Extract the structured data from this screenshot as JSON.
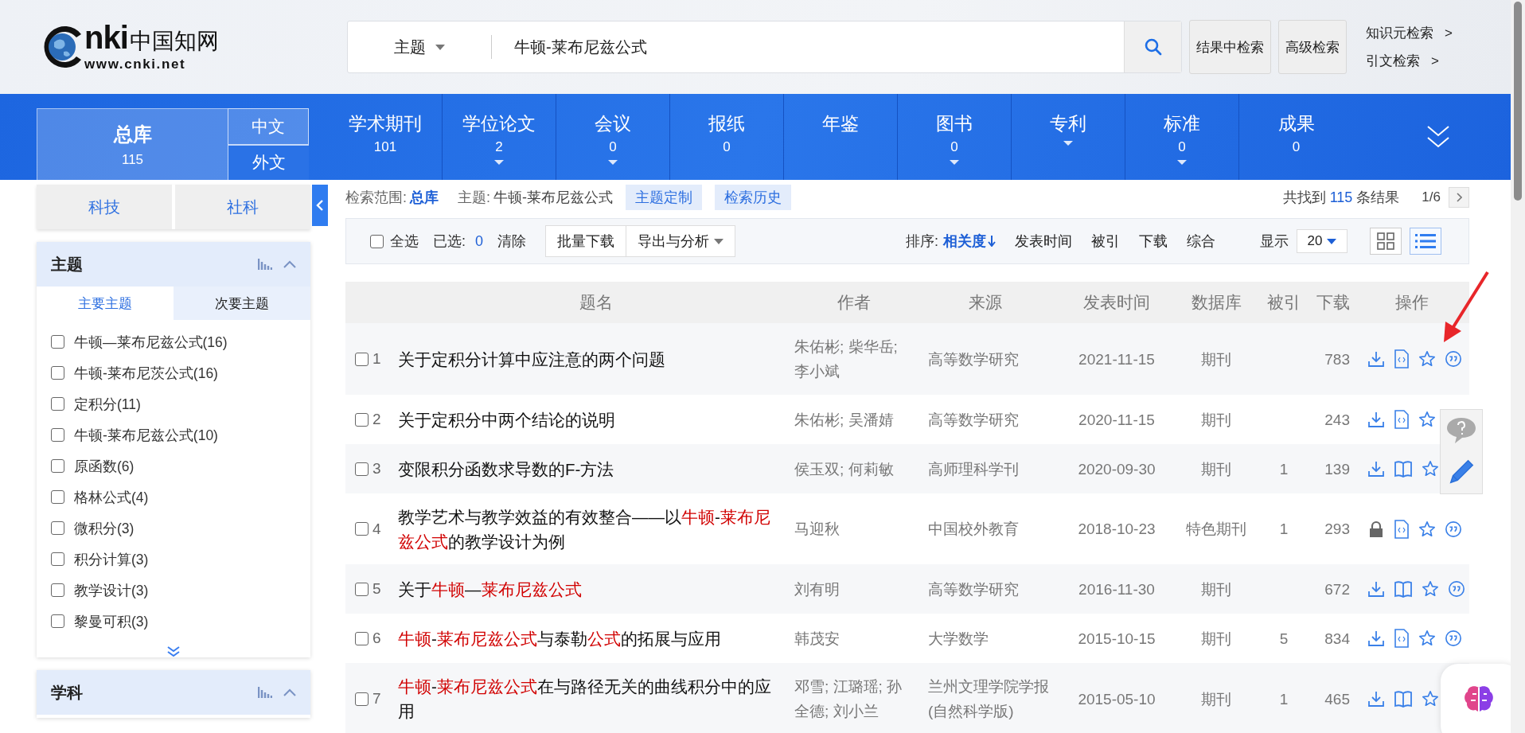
{
  "logo": {
    "mark": "nki",
    "name": "中国知网",
    "url": "www.cnki.net"
  },
  "search": {
    "field": "主题",
    "query": "牛顿-莱布尼兹公式"
  },
  "header_buttons": [
    "结果中检索",
    "高级检索"
  ],
  "header_links": [
    {
      "label": "知识元检索",
      "arrow": ">"
    },
    {
      "label": "引文检索",
      "arrow": ">"
    }
  ],
  "database_tabs": {
    "all": {
      "label": "总库",
      "count": "115"
    },
    "languages": [
      {
        "label": "中文",
        "selected": true
      },
      {
        "label": "外文",
        "selected": false
      }
    ]
  },
  "categories": [
    {
      "label": "学术期刊",
      "count": "101",
      "has_menu": false
    },
    {
      "label": "学位论文",
      "count": "2",
      "has_menu": true
    },
    {
      "label": "会议",
      "count": "0",
      "has_menu": true
    },
    {
      "label": "报纸",
      "count": "0",
      "has_menu": false
    },
    {
      "label": "年鉴",
      "has_menu": false
    },
    {
      "label": "图书",
      "count": "0",
      "has_menu": true
    },
    {
      "label": "专利",
      "has_menu": true
    },
    {
      "label": "标准",
      "count": "0",
      "has_menu": true
    },
    {
      "label": "成果",
      "count": "0",
      "has_menu": false
    }
  ],
  "sidebar": {
    "field_tabs": [
      "科技",
      "社科"
    ],
    "facets": [
      {
        "title": "主题",
        "subtabs": [
          {
            "label": "主要主题",
            "selected": true
          },
          {
            "label": "次要主题",
            "selected": false
          }
        ],
        "items": [
          {
            "label": "牛顿—莱布尼兹公式(16)",
            "checked": false
          },
          {
            "label": "牛顿-莱布尼茨公式(16)",
            "checked": false
          },
          {
            "label": "定积分(11)",
            "checked": false
          },
          {
            "label": "牛顿-莱布尼兹公式(10)",
            "checked": false
          },
          {
            "label": "原函数(6)",
            "checked": false
          },
          {
            "label": "格林公式(4)",
            "checked": false
          },
          {
            "label": "微积分(3)",
            "checked": false
          },
          {
            "label": "积分计算(3)",
            "checked": false
          },
          {
            "label": "教学设计(3)",
            "checked": false
          },
          {
            "label": "黎曼可积(3)",
            "checked": false
          }
        ]
      },
      {
        "title": "学科"
      }
    ]
  },
  "breadcrumb": {
    "scope_label": "检索范围:",
    "scope": "总库",
    "query_label": "主题:",
    "query": "牛顿-莱布尼兹公式",
    "actions": [
      "主题定制",
      "检索历史"
    ]
  },
  "result_summary": {
    "prefix": "共找到",
    "count": "115",
    "suffix": "条结果",
    "page": "1/6"
  },
  "toolbar": {
    "select_all": {
      "label": "全选",
      "checked": false
    },
    "selected_label": "已选:",
    "selected_count": "0",
    "clear": "清除",
    "buttons": [
      {
        "label": "批量下载",
        "has_menu": false
      },
      {
        "label": "导出与分析",
        "has_menu": true
      }
    ],
    "sort_label": "排序:",
    "sort_options": [
      {
        "label": "相关度",
        "selected": true
      },
      {
        "label": "发表时间",
        "selected": false
      },
      {
        "label": "被引",
        "selected": false
      },
      {
        "label": "下载",
        "selected": false
      },
      {
        "label": "综合",
        "selected": false
      }
    ],
    "page_size_label": "显示",
    "page_size": "20",
    "views": [
      {
        "kind": "grid",
        "selected": false
      },
      {
        "kind": "list",
        "selected": true
      }
    ]
  },
  "table": {
    "columns": [
      "题名",
      "作者",
      "来源",
      "发表时间",
      "数据库",
      "被引",
      "下载",
      "操作"
    ],
    "rows": [
      {
        "number": "1",
        "checked": false,
        "title": [
          {
            "text": "关于定积分计算中应注意的两个问题",
            "highlight": false
          }
        ],
        "authors": "朱佑彬; 柴华岳; 李小斌",
        "source": "高等数学研究",
        "date": "2021-11-15",
        "database": "期刊",
        "downloads": "783",
        "actions": [
          {
            "kind": "download"
          },
          {
            "kind": "html"
          },
          {
            "kind": "favorite"
          },
          {
            "kind": "cite"
          }
        ]
      },
      {
        "number": "2",
        "checked": false,
        "title": [
          {
            "text": "关于定积分中两个结论的说明",
            "highlight": false
          }
        ],
        "authors": "朱佑彬; 吴潘婧",
        "source": "高等数学研究",
        "date": "2020-11-15",
        "database": "期刊",
        "downloads": "243",
        "actions": [
          {
            "kind": "download"
          },
          {
            "kind": "html"
          },
          {
            "kind": "favorite"
          }
        ]
      },
      {
        "number": "3",
        "checked": false,
        "title": [
          {
            "text": "变限积分函数求导数的F-方法",
            "highlight": false
          }
        ],
        "authors": "侯玉双; 何莉敏",
        "source": "高师理科学刊",
        "date": "2020-09-30",
        "database": "期刊",
        "cited": "1",
        "downloads": "139",
        "actions": [
          {
            "kind": "download"
          },
          {
            "kind": "read"
          },
          {
            "kind": "favorite"
          }
        ]
      },
      {
        "number": "4",
        "checked": false,
        "title": [
          {
            "text": "教学艺术与教学效益的有效整合——以",
            "highlight": false
          },
          {
            "text": "牛顿",
            "highlight": true
          },
          {
            "text": "-",
            "highlight": false
          },
          {
            "text": "莱布尼兹公式",
            "highlight": true
          },
          {
            "text": "的教学设计为例",
            "highlight": false
          }
        ],
        "authors": "马迎秋",
        "source": "中国校外教育",
        "date": "2018-10-23",
        "database": "特色期刊",
        "cited": "1",
        "downloads": "293",
        "actions": [
          {
            "kind": "locked"
          },
          {
            "kind": "html"
          },
          {
            "kind": "favorite"
          },
          {
            "kind": "cite"
          }
        ]
      },
      {
        "number": "5",
        "checked": false,
        "title": [
          {
            "text": "关于",
            "highlight": false
          },
          {
            "text": "牛顿",
            "highlight": true
          },
          {
            "text": "—",
            "highlight": false
          },
          {
            "text": "莱布尼兹公式",
            "highlight": true
          }
        ],
        "authors": "刘有明",
        "source": "高等数学研究",
        "date": "2016-11-30",
        "database": "期刊",
        "downloads": "672",
        "actions": [
          {
            "kind": "download"
          },
          {
            "kind": "read"
          },
          {
            "kind": "favorite"
          },
          {
            "kind": "cite"
          }
        ]
      },
      {
        "number": "6",
        "checked": false,
        "title": [
          {
            "text": "牛顿",
            "highlight": true
          },
          {
            "text": "-",
            "highlight": false
          },
          {
            "text": "莱布尼兹公式",
            "highlight": true
          },
          {
            "text": "与泰勒",
            "highlight": false
          },
          {
            "text": "公式",
            "highlight": true
          },
          {
            "text": "的拓展与应用",
            "highlight": false
          }
        ],
        "authors": "韩茂安",
        "source": "大学数学",
        "date": "2015-10-15",
        "database": "期刊",
        "cited": "5",
        "downloads": "834",
        "actions": [
          {
            "kind": "download"
          },
          {
            "kind": "html"
          },
          {
            "kind": "favorite"
          },
          {
            "kind": "cite"
          }
        ]
      },
      {
        "number": "7",
        "checked": false,
        "title": [
          {
            "text": "牛顿",
            "highlight": true
          },
          {
            "text": "-",
            "highlight": false
          },
          {
            "text": "莱布尼兹公式",
            "highlight": true
          },
          {
            "text": "在与路径无关的曲线积分中的应用",
            "highlight": false
          }
        ],
        "authors": "邓雪; 江璐瑶; 孙全德; 刘小兰",
        "source": "兰州文理学院学报(自然科学版)",
        "date": "2015-05-10",
        "database": "期刊",
        "cited": "1",
        "downloads": "465",
        "actions": [
          {
            "kind": "download"
          },
          {
            "kind": "read"
          },
          {
            "kind": "favorite"
          }
        ]
      }
    ]
  }
}
